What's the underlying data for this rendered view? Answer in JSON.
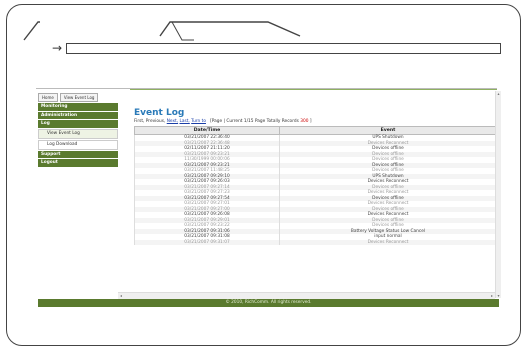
{
  "browser": {
    "nav_arrow": "→",
    "address": ""
  },
  "breadcrumb": [
    "Home",
    "View Event Log"
  ],
  "sidebar": {
    "sections": [
      {
        "label": "Monitoring",
        "items": []
      },
      {
        "label": "Administration",
        "items": []
      },
      {
        "label": "Log",
        "items": [
          "View Event Log",
          "Log Download"
        ]
      },
      {
        "label": "Support",
        "items": []
      },
      {
        "label": "Logout",
        "items": []
      }
    ]
  },
  "page": {
    "title": "Event Log",
    "nav": {
      "first": "First,",
      "previous": "Previous,",
      "next": "Next,",
      "last": "Last,",
      "turn_to": "Turn to",
      "page_info": "[Page | Current 1/15 Page Totally Records",
      "records": "300",
      "page_info_end": "]"
    },
    "table": {
      "headers": [
        "Date/Time",
        "Event"
      ],
      "rows": [
        {
          "time": "03/21/2007 22:36:40",
          "event": "UPS Shutdown"
        },
        {
          "time": "03/21/2007 22:36:48",
          "event": "Devices Reconnect"
        },
        {
          "time": "02/11/2007 21:11:20",
          "event": "Devices offline"
        },
        {
          "time": "03/21/2007 09:23:21",
          "event": "Devices offline"
        },
        {
          "time": "11/30/1999 00:00:06",
          "event": "Devices offline"
        },
        {
          "time": "03/21/2007 09:23:21",
          "event": "Devices offline"
        },
        {
          "time": "03/21/2007 11:48:25",
          "event": "Devices offline"
        },
        {
          "time": "03/21/2007 09:29:10",
          "event": "UPS Shutdown"
        },
        {
          "time": "03/21/2007 09:26:03",
          "event": "Devices Reconnect"
        },
        {
          "time": "03/21/2007 09:27:14",
          "event": "Devices offline"
        },
        {
          "time": "03/21/2007 09:27:23",
          "event": "Devices Reconnect"
        },
        {
          "time": "03/21/2007 09:27:54",
          "event": "Devices offline"
        },
        {
          "time": "03/21/2007 09:27:01",
          "event": "Devices Reconnect"
        },
        {
          "time": "03/21/2007 09:27:00",
          "event": "Devices offline"
        },
        {
          "time": "03/21/2007 09:26:08",
          "event": "Devices Reconnect"
        },
        {
          "time": "03/21/2007 09:29:01",
          "event": "Devices offline"
        },
        {
          "time": "03/21/2007 09:23:22",
          "event": "Devices offline"
        },
        {
          "time": "03/21/2007 09:31:06",
          "event": "Battery Voltage Status Low Cancel"
        },
        {
          "time": "03/21/2007 09:31:08",
          "event": "input normal"
        },
        {
          "time": "03/21/2007 09:31:07",
          "event": "Devices Reconnect"
        }
      ]
    }
  },
  "footer": {
    "text": "© 2010, RichComm. All rights reserved."
  },
  "colors": {
    "brand_green": "#5a7a2e",
    "title_blue": "#2a7ab8",
    "link_blue": "#1a3ea8",
    "alert_red": "#cc0000"
  }
}
